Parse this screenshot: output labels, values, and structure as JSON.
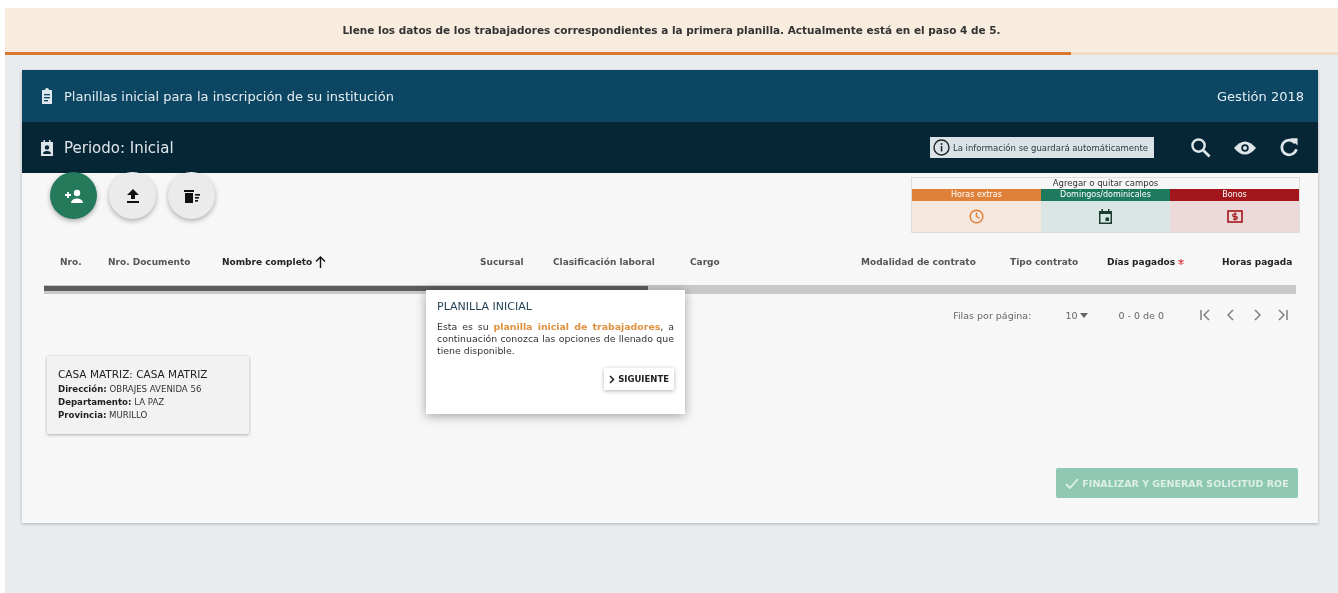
{
  "banner": {
    "message": "Llene los datos de los trabajadores correspondientes a la primera planilla. Actualmente está en el paso 4 de 5.",
    "progress": {
      "level": 0.8
    }
  },
  "card": {
    "title": "Planillas inicial para la inscripción de su institución",
    "year": "Gestión 2018",
    "period": "Periodo: Inicial",
    "autosave_note": "La información se guardará automáticamente",
    "fields_panel": {
      "title": "Agregar o quitar campos",
      "fields": [
        {
          "label": "Horas extras",
          "color": "#e0813a",
          "kind": "clock"
        },
        {
          "label": "Domingos/dominicales",
          "color": "#1e7a5e",
          "kind": "calendar"
        },
        {
          "label": "Bonos",
          "color": "#a3161b",
          "kind": "money"
        }
      ]
    },
    "columns": [
      {
        "label": "Nro.",
        "active": false,
        "sorted": false,
        "required": false
      },
      {
        "label": "Nro. Documento",
        "active": false,
        "sorted": false,
        "required": false
      },
      {
        "label": "Nombre completo",
        "active": true,
        "sorted": true,
        "required": false
      },
      {
        "label": "Sucursal",
        "active": false,
        "sorted": false,
        "required": false
      },
      {
        "label": "Clasificación laboral",
        "active": false,
        "sorted": false,
        "required": false
      },
      {
        "label": "Cargo",
        "active": false,
        "sorted": false,
        "required": false
      },
      {
        "label": "Modalidad de contrato",
        "active": false,
        "sorted": false,
        "required": false
      },
      {
        "label": "Tipo contrato",
        "active": false,
        "sorted": false,
        "required": false
      },
      {
        "label": "Días pagados",
        "active": true,
        "sorted": false,
        "required": true
      },
      {
        "label": "Horas pagada",
        "active": true,
        "sorted": false,
        "required": false
      }
    ],
    "pagination": {
      "rows_label": "Filas por página:",
      "rows_value": "10",
      "range": "0 - 0 de 0"
    },
    "branch": {
      "title": "CASA MATRIZ: CASA MATRIZ",
      "lines": [
        {
          "label": "Dirección:",
          "value": "OBRAJES AVENIDA 56"
        },
        {
          "label": "Departamento:",
          "value": "LA PAZ"
        },
        {
          "label": "Provincia:",
          "value": "MURILLO"
        }
      ]
    },
    "finish_button": {
      "label": "FINALIZAR Y GENERAR SOLICITUD ROE",
      "disabled": true
    }
  },
  "popover": {
    "title": "PLANILLA INICIAL",
    "text": "Esta es su **planilla inicial de trabajadores**, a continuación conozca las opciones de llenado que tiene disponible.",
    "button": "SIGUIENTE"
  }
}
